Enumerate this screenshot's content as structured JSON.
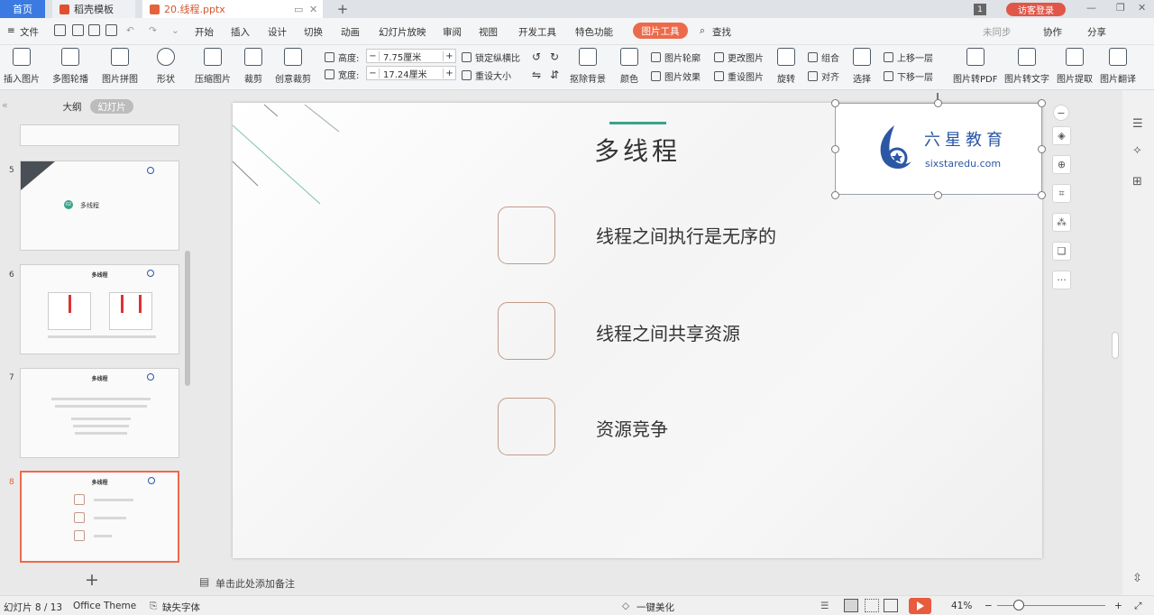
{
  "tabs": {
    "home": "首页",
    "templates": "稻壳模板",
    "document": "20.线程.pptx",
    "add": "+",
    "login": "访客登录",
    "page_badge": "1"
  },
  "menu": {
    "file": "文件",
    "items": [
      "开始",
      "插入",
      "设计",
      "切换",
      "动画",
      "幻灯片放映",
      "审阅",
      "视图",
      "开发工具",
      "特色功能"
    ],
    "picture_tools": "图片工具",
    "search": "查找",
    "sync": "未同步",
    "collab": "协作",
    "share": "分享"
  },
  "ribbon": {
    "insert_picture": "插入图片",
    "multi_contour": "多图轮播",
    "picture_collage": "图片拼图",
    "shape": "形状",
    "compress": "压缩图片",
    "crop": "裁剪",
    "creative_crop": "创意裁剪",
    "height_label": "高度:",
    "height_value": "7.75厘米",
    "width_label": "宽度:",
    "width_value": "17.24厘米",
    "lock_ratio": "锁定纵横比",
    "reset_size": "重设大小",
    "remove_bg": "抠除背景",
    "color": "颜色",
    "pic_outline": "图片轮廓",
    "pic_effect": "图片效果",
    "change_pic": "更改图片",
    "reset_pic": "重设图片",
    "rotate": "旋转",
    "group": "组合",
    "align": "对齐",
    "select": "选择",
    "bring_forward": "上移一层",
    "send_backward": "下移一层",
    "to_pdf": "图片转PDF",
    "to_text": "图片转文字",
    "extract": "图片提取",
    "translate": "图片翻译"
  },
  "left_panel": {
    "outline_tab": "大纲",
    "slides_tab": "幻灯片",
    "thumbnails": [
      {
        "num": "5",
        "title": "多线程",
        "badge": "02"
      },
      {
        "num": "6",
        "title": "多线程"
      },
      {
        "num": "7",
        "title": "多线程"
      },
      {
        "num": "8",
        "title": "多线程"
      }
    ]
  },
  "slide": {
    "title": "多线程",
    "bullets": [
      "线程之间执行是无序的",
      "线程之间共享资源",
      "资源竞争"
    ],
    "logo_cn": "六星教育",
    "logo_en": "sixstaredu.com"
  },
  "notes_placeholder": "单击此处添加备注",
  "status": {
    "slide_count": "幻灯片 8 / 13",
    "theme": "Office Theme",
    "missing_font": "缺失字体",
    "beautify": "一键美化",
    "zoom": "41%"
  },
  "colors": {
    "accent": "#ec6a4c",
    "home_tab": "#3b7ae0",
    "title_accent": "#3aa389",
    "logo_blue": "#2b57a5"
  }
}
